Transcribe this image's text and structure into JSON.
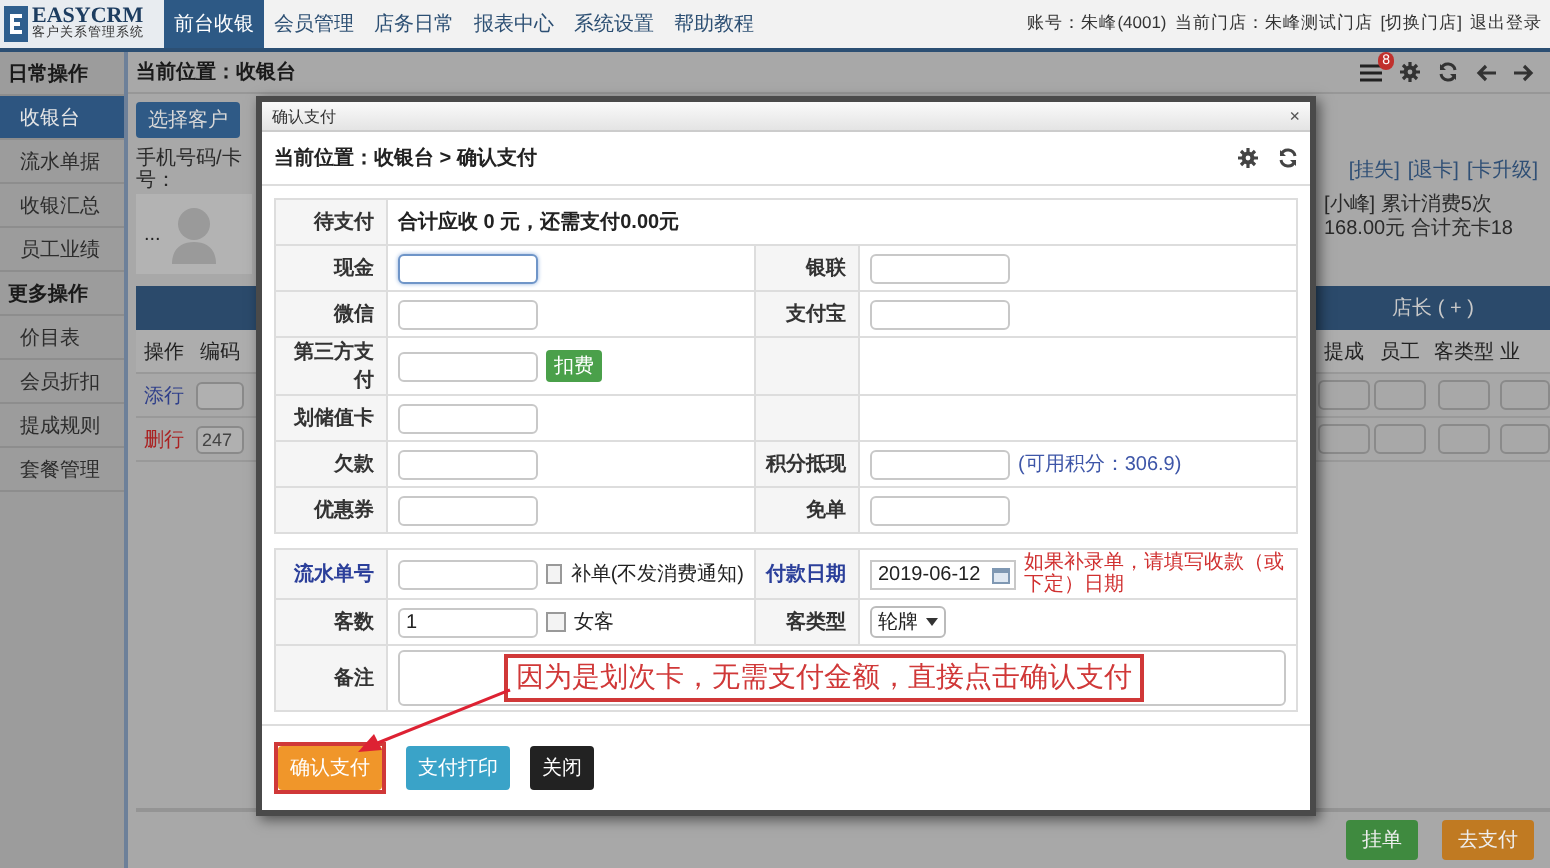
{
  "header": {
    "logo": {
      "title": "EASYCRM",
      "subtitle": "客户关系管理系统"
    },
    "nav": [
      {
        "label": "前台收银",
        "selected": true
      },
      {
        "label": "会员管理",
        "selected": false
      },
      {
        "label": "店务日常",
        "selected": false
      },
      {
        "label": "报表中心",
        "selected": false
      },
      {
        "label": "系统设置",
        "selected": false
      },
      {
        "label": "帮助教程",
        "selected": false
      }
    ],
    "account": "账号：朱峰(4001)",
    "store": "当前门店：朱峰测试门店",
    "switch_link": "[切换门店]",
    "logout": "退出登录"
  },
  "sidebar": {
    "sections": [
      {
        "title": "日常操作",
        "items": [
          {
            "label": "收银台",
            "selected": true
          },
          {
            "label": "流水单据",
            "selected": false
          },
          {
            "label": "收银汇总",
            "selected": false
          },
          {
            "label": "员工业绩",
            "selected": false
          }
        ]
      },
      {
        "title": "更多操作",
        "items": [
          {
            "label": "价目表",
            "selected": false
          },
          {
            "label": "会员折扣",
            "selected": false
          },
          {
            "label": "提成规则",
            "selected": false
          },
          {
            "label": "套餐管理",
            "selected": false
          }
        ]
      }
    ]
  },
  "page": {
    "breadcrumb": "当前位置：收银台",
    "notification_count": "8",
    "select_customer_button": "选择客户",
    "phone_label": "手机号码/卡号：",
    "card_links": [
      "[挂失]",
      "[退卡]",
      "[卡升级]"
    ],
    "more_button": "...",
    "member_info": "[小峰] 累计消费5次 168.00元 合计充卡18",
    "table": {
      "group_header": "店长 ( + )",
      "left_columns": [
        "操作",
        "编码"
      ],
      "right_columns": [
        "提成",
        "员工",
        "客类型",
        "业"
      ],
      "rows": [
        {
          "action": "添行",
          "kind": "add"
        },
        {
          "action": "删行",
          "kind": "delete",
          "code": "247"
        }
      ]
    },
    "bottom_buttons": [
      {
        "label": "挂单",
        "kind": "hold"
      },
      {
        "label": "去支付",
        "kind": "pay"
      }
    ]
  },
  "dialog": {
    "title": "确认支付",
    "close": "×",
    "breadcrumb": "当前位置：收银台 > 确认支付",
    "due_label": "待支付",
    "due_text": "合计应收 0 元，还需支付0.00元",
    "payment_rows": [
      {
        "left": {
          "label": "现金",
          "kind": "input",
          "focused": true
        },
        "right": {
          "label": "银联",
          "kind": "input",
          "focused": false
        }
      },
      {
        "left": {
          "label": "微信",
          "kind": "input",
          "focused": false
        },
        "right": {
          "label": "支付宝",
          "kind": "input",
          "focused": false
        }
      },
      {
        "left": {
          "label": "第三方支付",
          "kind": "input",
          "focused": false,
          "button": "扣费"
        }
      },
      {
        "left": {
          "label": "划储值卡",
          "kind": "input",
          "focused": false
        }
      },
      {
        "left": {
          "label": "欠款",
          "kind": "input",
          "focused": false
        },
        "right": {
          "label": "积分抵现",
          "kind": "input",
          "focused": false,
          "note": "(可用积分：306.9)"
        }
      },
      {
        "left": {
          "label": "优惠券",
          "kind": "input",
          "focused": false
        },
        "right": {
          "label": "免单",
          "kind": "input",
          "focused": false
        }
      }
    ],
    "detail_rows": [
      {
        "left": {
          "label": "流水单号",
          "linked": true,
          "kind": "input",
          "checkbox": {
            "label": "补单(不发消费通知)",
            "checked": false
          }
        },
        "right": {
          "label": "付款日期",
          "linked": true,
          "kind": "date",
          "value": "2019-06-12",
          "warning": "如果补录单，请填写收款（或下定）日期"
        }
      },
      {
        "left": {
          "label": "客数",
          "linked": false,
          "kind": "input",
          "value": "1",
          "checkbox": {
            "label": "女客",
            "checked": false
          }
        },
        "right": {
          "label": "客类型",
          "linked": false,
          "kind": "select",
          "value": "轮牌"
        }
      }
    ],
    "remark_label": "备注",
    "buttons": [
      {
        "label": "确认支付",
        "kind": "confirm"
      },
      {
        "label": "支付打印",
        "kind": "print"
      },
      {
        "label": "关闭",
        "kind": "close"
      }
    ],
    "callout": "因为是划次卡，无需支付金额，直接点击确认支付"
  }
}
